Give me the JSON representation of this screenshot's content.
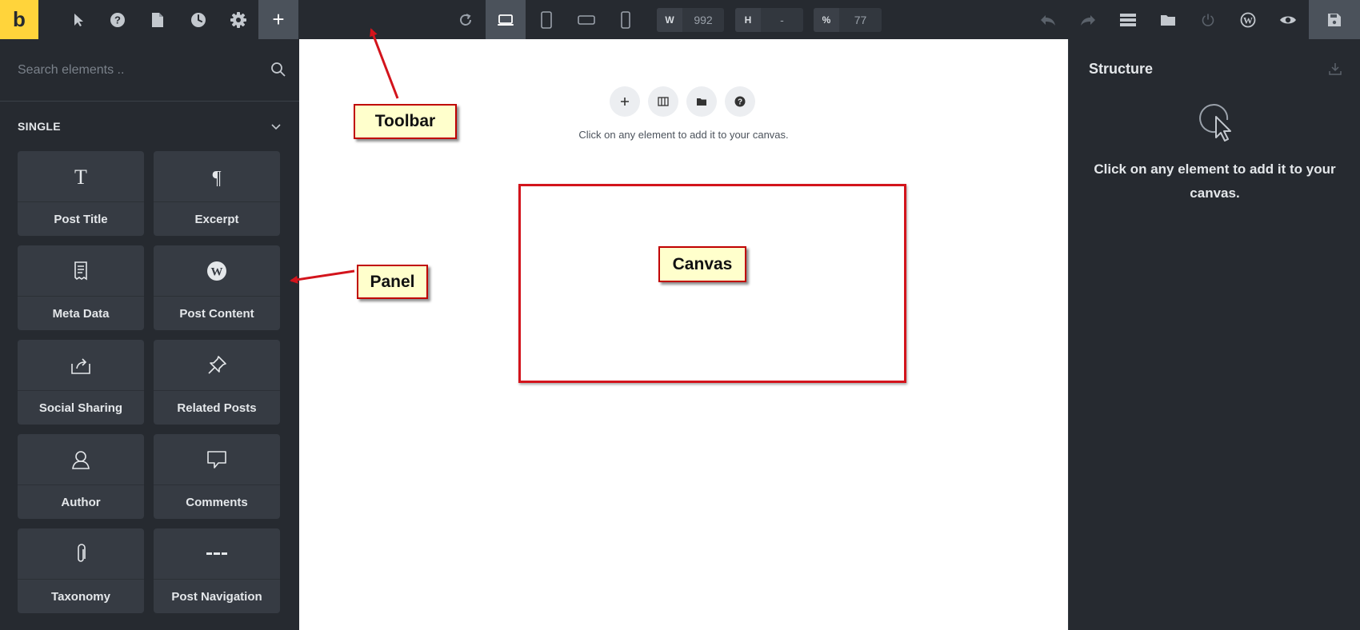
{
  "toolbar": {
    "logo": "b",
    "add_label": "+",
    "width_label": "W",
    "width_value": "992",
    "height_label": "H",
    "height_value": "-",
    "zoom_label": "%",
    "zoom_value": "77",
    "icons": [
      "cursor-icon",
      "help-icon",
      "page-icon",
      "history-icon",
      "settings-icon",
      "refresh-icon",
      "desktop-icon",
      "tablet-portrait-icon",
      "tablet-landscape-icon",
      "mobile-icon",
      "undo-icon",
      "redo-icon",
      "menu-icon",
      "folder-icon",
      "power-icon",
      "wordpress-icon",
      "preview-icon",
      "save-icon"
    ]
  },
  "panel": {
    "search_placeholder": "Search elements ..",
    "category": "SINGLE",
    "elements": [
      {
        "label": "Post Title",
        "icon": "text-t-icon"
      },
      {
        "label": "Excerpt",
        "icon": "paragraph-icon"
      },
      {
        "label": "Meta Data",
        "icon": "receipt-icon"
      },
      {
        "label": "Post Content",
        "icon": "wordpress-icon"
      },
      {
        "label": "Social Sharing",
        "icon": "share-icon"
      },
      {
        "label": "Related Posts",
        "icon": "pin-icon"
      },
      {
        "label": "Author",
        "icon": "user-icon"
      },
      {
        "label": "Comments",
        "icon": "comment-icon"
      },
      {
        "label": "Taxonomy",
        "icon": "paperclip-icon"
      },
      {
        "label": "Post Navigation",
        "icon": "dashes-icon"
      }
    ]
  },
  "canvas": {
    "hint": "Click on any element to add it to your canvas.",
    "buttons": [
      "add-icon",
      "columns-icon",
      "folder-icon",
      "help-icon"
    ]
  },
  "structure": {
    "title": "Structure",
    "message": "Click on any element to add it to your canvas."
  },
  "annotations": {
    "toolbar": "Toolbar",
    "panel": "Panel",
    "canvas": "Canvas"
  },
  "colors": {
    "logo_bg": "#ffd43b",
    "dark_bg": "#262a30",
    "card_bg": "#363b43",
    "active_bg": "#4b525b",
    "annotation_border": "#c00000",
    "annotation_fill": "#ffffcc"
  }
}
